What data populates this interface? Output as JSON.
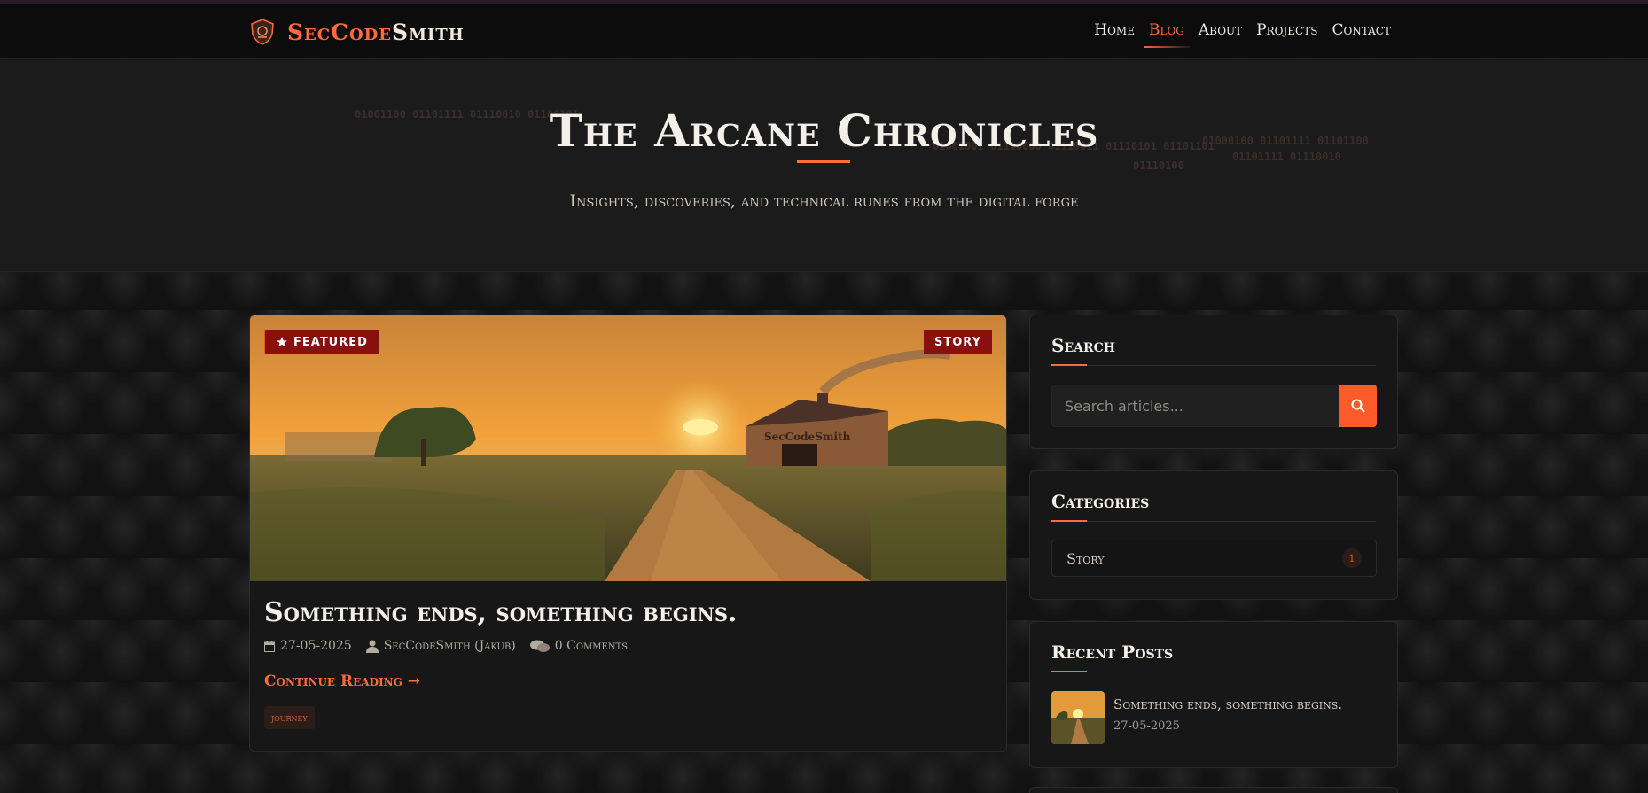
{
  "brand": {
    "name_part1": "SecCode",
    "name_part2": "Smith"
  },
  "nav": {
    "items": [
      {
        "label": "Home",
        "active": false
      },
      {
        "label": "Blog",
        "active": true
      },
      {
        "label": "About",
        "active": false
      },
      {
        "label": "Projects",
        "active": false
      },
      {
        "label": "Contact",
        "active": false
      }
    ]
  },
  "hero": {
    "title": "The Arcane Chronicles",
    "subtitle": "Insights, discoveries, and technical runes from the digital forge",
    "binary": [
      "01001100 01101111 01110010 01100101",
      "01001001 01110000 01110011 01110101 01101101",
      "01000100 01101111 01101100",
      "01101111 01110010",
      "01110100"
    ]
  },
  "post": {
    "featured_label": "FEATURED",
    "category_badge": "STORY",
    "title": "Something ends, something begins.",
    "date": "27-05-2025",
    "author": "SecCodeSmith (Jakub)",
    "comments": "0 Comments",
    "continue_label": "Continue Reading →",
    "tag": "journey",
    "image_watermark": "SecCodeSmith"
  },
  "sidebar": {
    "search": {
      "title": "Search",
      "placeholder": "Search articles..."
    },
    "categories": {
      "title": "Categories",
      "items": [
        {
          "label": "Story",
          "count": "1"
        }
      ]
    },
    "recent": {
      "title": "Recent Posts",
      "items": [
        {
          "title": "Something ends, something begins.",
          "date": "27-05-2025"
        }
      ]
    }
  },
  "colors": {
    "accent": "#ff6b3d",
    "badge_red": "#8a0f0f",
    "background": "#121212"
  }
}
